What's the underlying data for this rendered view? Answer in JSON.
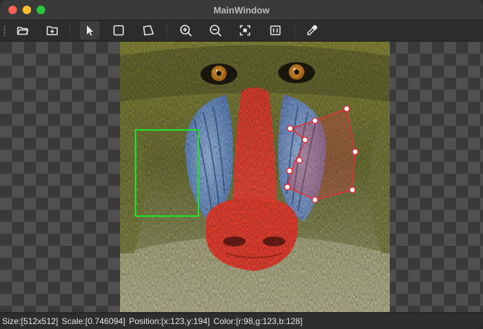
{
  "window": {
    "title": "MainWindow"
  },
  "toolbar": {
    "buttons": [
      {
        "name": "open-folder-icon"
      },
      {
        "name": "add-file-icon"
      },
      {
        "name": "select-pointer-icon",
        "active": true
      },
      {
        "name": "rectangle-tool-icon"
      },
      {
        "name": "polygon-tool-icon"
      },
      {
        "name": "zoom-in-icon"
      },
      {
        "name": "zoom-out-icon"
      },
      {
        "name": "fit-to-window-icon"
      },
      {
        "name": "actual-size-icon"
      },
      {
        "name": "color-picker-icon"
      }
    ]
  },
  "colors": {
    "rect_annotation": "#22e02a",
    "polygon_annotation": "#e0303a"
  },
  "status": {
    "size": "Size:[512x512]",
    "scale": "Scale:[0.746094]",
    "position": "Position:[x:123,y:194]",
    "color": "Color:[r:98,g:123,b:128]"
  }
}
